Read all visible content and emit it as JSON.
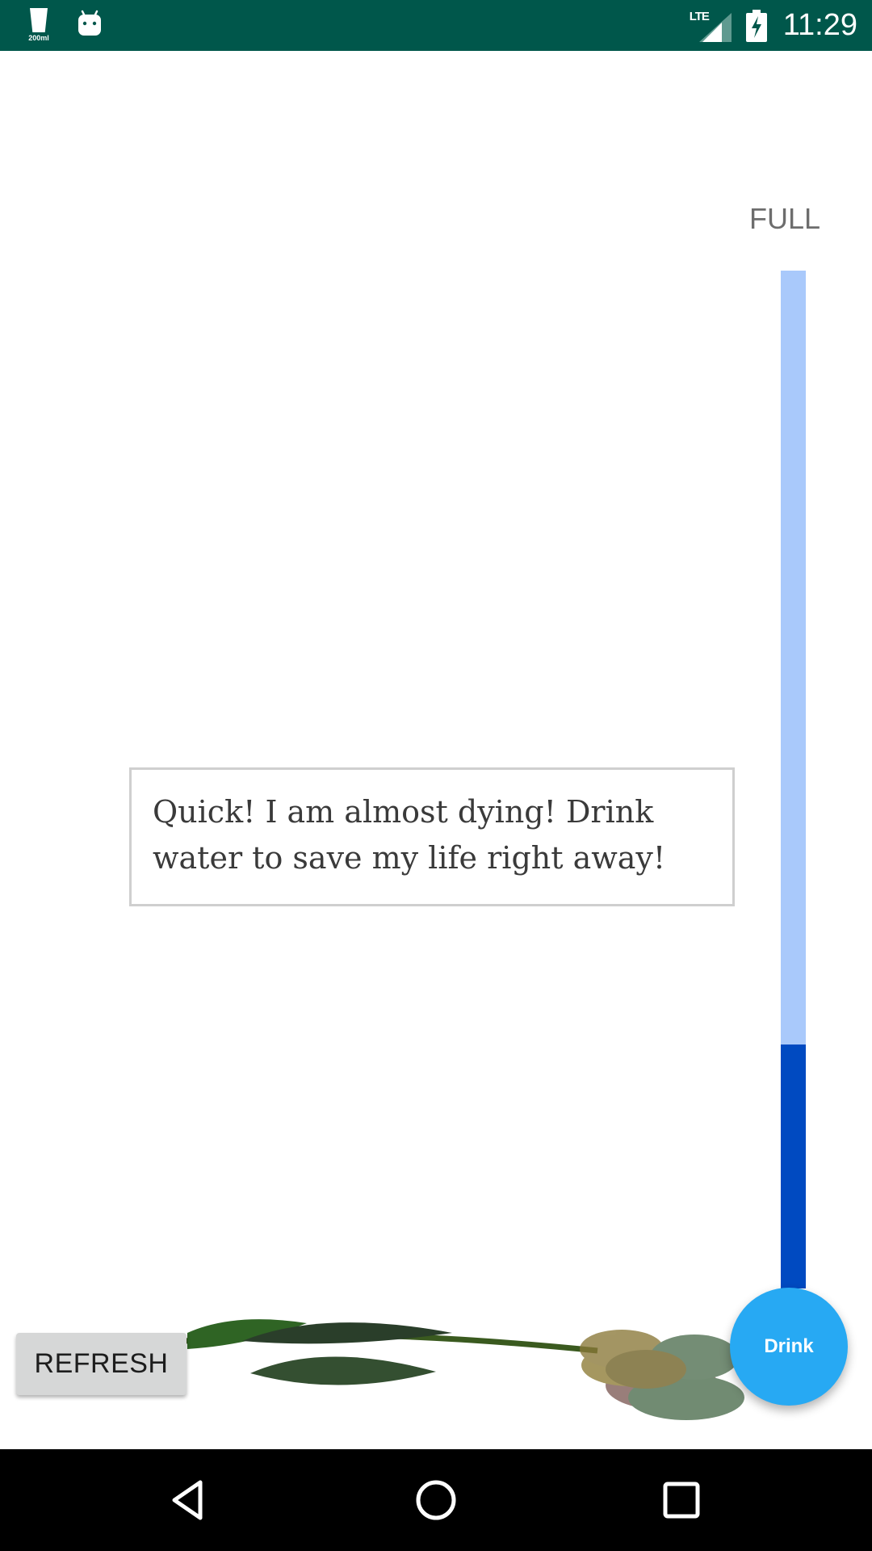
{
  "status_bar": {
    "cup_label": "200ml",
    "network": "LTE",
    "time": "11:29",
    "icons": [
      "water-cup-icon",
      "android-icon",
      "lte-signal-icon",
      "battery-charging-icon"
    ]
  },
  "gauge": {
    "label": "FULL",
    "level_fraction": 0.24,
    "empty_color": "#a9c9fb",
    "fill_color": "#004ac1"
  },
  "message": {
    "text": "Quick! I am almost dying! Drink water to save my life right away!"
  },
  "buttons": {
    "refresh_label": "REFRESH",
    "drink_label": "Drink"
  },
  "colors": {
    "status_bar": "#00574b",
    "fab": "#27a9f3",
    "refresh_bg": "#d6d7d7"
  },
  "nav_bar": {
    "icons": [
      "back-icon",
      "home-icon",
      "recents-icon"
    ]
  }
}
